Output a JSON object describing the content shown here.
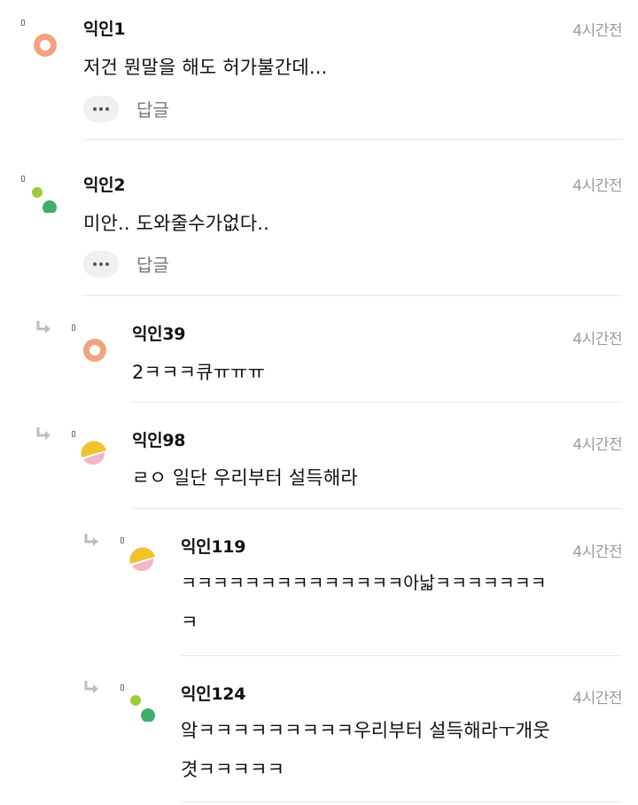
{
  "comments": [
    {
      "nick": "익인1",
      "time": "4시간전",
      "text": "저건 뭔말을 해도 허가불간데...",
      "reply_label": "답글",
      "avatar_icon": "orange-ring-avatar-icon"
    },
    {
      "nick": "익인2",
      "time": "4시간전",
      "text": "미안.. 도와줄수가없다..",
      "reply_label": "답글",
      "avatar_icon": "green-dots-avatar-icon"
    },
    {
      "nick": "익인39",
      "time": "4시간전",
      "text": "2ㅋㅋㅋ큐ㅠㅠㅠ",
      "avatar_icon": "orange-ring-avatar-icon"
    },
    {
      "nick": "익인98",
      "time": "4시간전",
      "text": "ㄹㅇ 일단 우리부터 설득해라",
      "avatar_icon": "yellow-pink-avatar-icon"
    },
    {
      "nick": "익인119",
      "time": "4시간전",
      "text_line1": "ㅋㅋㅋㅋㅋㅋㅋㅋㅋㅋㅋㅋㅋㅋ아낣ㅋㅋㅋㅋㅋㅋㅋ",
      "text_line2": "ㅋ",
      "avatar_icon": "yellow-pink-avatar-icon"
    },
    {
      "nick": "익인124",
      "time": "4시간전",
      "text_line1": "앜ㅋㅋㅋㅋㅋㅋㅋㅋㅋ우리부터 설득해라ㅜ개웃",
      "text_line2": "겻ㅋㅋㅋㅋㅋ",
      "avatar_icon": "green-dots-avatar-icon"
    }
  ],
  "colors": {
    "orange": "#f2a37b",
    "green": "#3fae6a",
    "lime": "#9ccc3a",
    "yellow": "#f2c12e",
    "pink": "#f3b6c4",
    "time_gray": "#9a9a9a"
  }
}
